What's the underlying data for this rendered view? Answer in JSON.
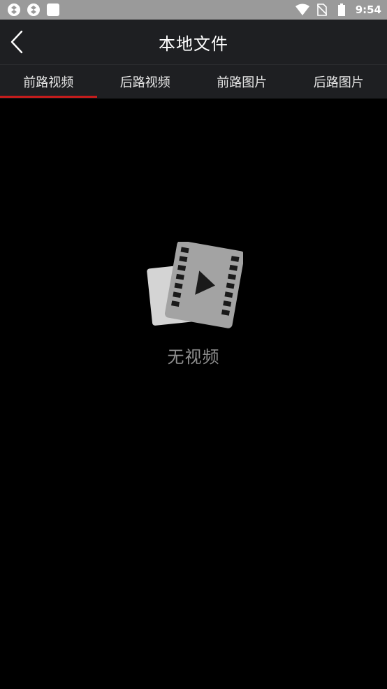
{
  "status_bar": {
    "time": "9:54",
    "icons": [
      "app-notification-icon",
      "app-notification-icon",
      "square-notification-icon",
      "wifi-icon",
      "no-sim-icon",
      "battery-icon"
    ]
  },
  "header": {
    "title": "本地文件",
    "back_icon": "chevron-left-icon"
  },
  "tabs": [
    {
      "label": "前路视频",
      "active": true
    },
    {
      "label": "后路视频",
      "active": false
    },
    {
      "label": "前路图片",
      "active": false
    },
    {
      "label": "后路图片",
      "active": false
    }
  ],
  "empty_state": {
    "icon": "film-video-icon",
    "message": "无视频"
  },
  "colors": {
    "accent": "#c41c1c",
    "status_bar": "#9a9a9a",
    "app_bar": "#1e1f22",
    "background": "#000000"
  }
}
